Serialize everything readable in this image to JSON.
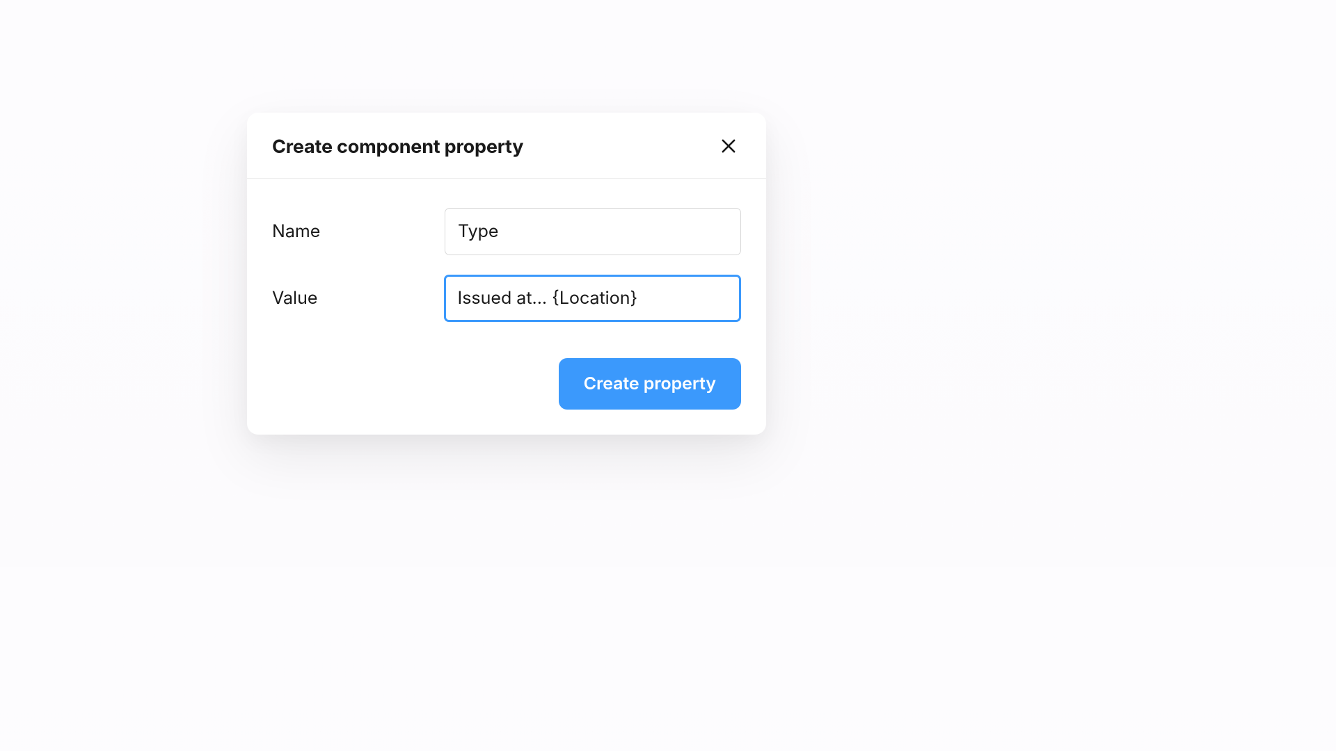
{
  "dialog": {
    "title": "Create component property",
    "fields": {
      "name": {
        "label": "Name",
        "value": "Type"
      },
      "value": {
        "label": "Value",
        "value": "Issued at... {Location}"
      }
    },
    "actions": {
      "submit_label": "Create property"
    }
  },
  "colors": {
    "accent": "#3b99fc",
    "text": "#1a1a1a",
    "border": "#d9d9d9"
  }
}
